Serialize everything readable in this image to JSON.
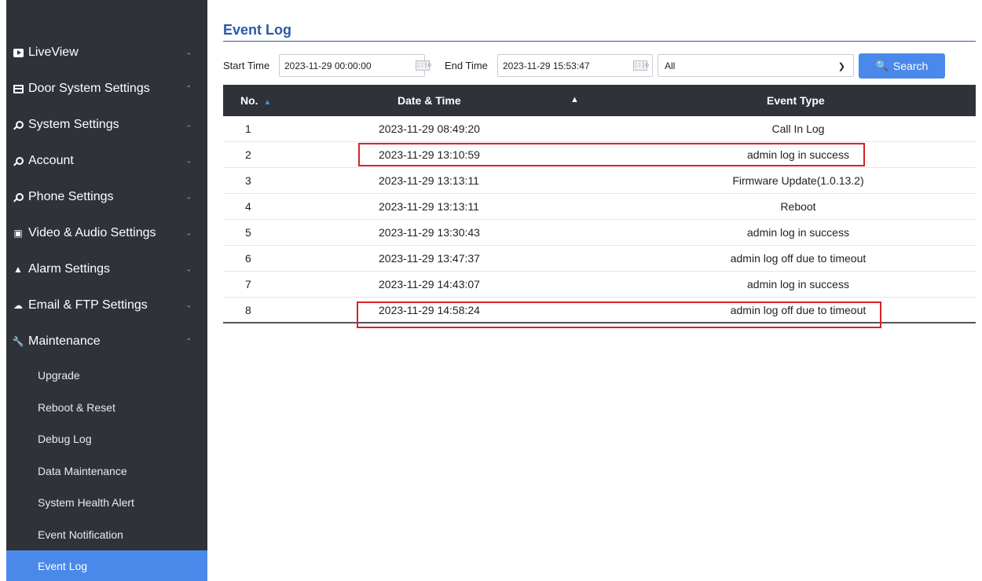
{
  "sidebar": {
    "items": [
      {
        "label": "LiveView",
        "icon": "video-icon"
      },
      {
        "label": "Door System Settings",
        "icon": "card-icon"
      },
      {
        "label": "System Settings",
        "icon": "key-icon"
      },
      {
        "label": "Account",
        "icon": "key-icon"
      },
      {
        "label": "Phone Settings",
        "icon": "key-icon"
      },
      {
        "label": "Video & Audio Settings",
        "icon": "camera-icon"
      },
      {
        "label": "Alarm Settings",
        "icon": "bell-icon"
      },
      {
        "label": "Email & FTP Settings",
        "icon": "cloud-icon"
      },
      {
        "label": "Maintenance",
        "icon": "wrench-icon"
      }
    ],
    "maintenance_items": [
      "Upgrade",
      "Reboot & Reset",
      "Debug Log",
      "Data Maintenance",
      "System Health Alert",
      "Event Notification",
      "Event Log"
    ],
    "active_item": "Event Log"
  },
  "page": {
    "title": "Event Log"
  },
  "filter": {
    "start_label": "Start Time",
    "start_value": "2023-11-29 00:00:00",
    "end_label": "End Time",
    "end_value": "2023-11-29 15:53:47",
    "type_value": "All",
    "search_label": "Search"
  },
  "table": {
    "headers": {
      "no": "No.",
      "datetime": "Date & Time",
      "type": "Event Type"
    },
    "rows": [
      {
        "no": "1",
        "datetime": "2023-11-29 08:49:20",
        "type": "Call In Log"
      },
      {
        "no": "2",
        "datetime": "2023-11-29 13:10:59",
        "type": "admin log in success"
      },
      {
        "no": "3",
        "datetime": "2023-11-29 13:13:11",
        "type": "Firmware Update(1.0.13.2)"
      },
      {
        "no": "4",
        "datetime": "2023-11-29 13:13:11",
        "type": "Reboot"
      },
      {
        "no": "5",
        "datetime": "2023-11-29 13:30:43",
        "type": "admin log in success"
      },
      {
        "no": "6",
        "datetime": "2023-11-29 13:47:37",
        "type": "admin log off due to timeout"
      },
      {
        "no": "7",
        "datetime": "2023-11-29 14:43:07",
        "type": "admin log in success"
      },
      {
        "no": "8",
        "datetime": "2023-11-29 14:58:24",
        "type": "admin log off due to timeout"
      }
    ]
  },
  "colors": {
    "accent": "#4a89ea",
    "sidebar_bg": "#2f3238",
    "highlight": "#d7222a",
    "title": "#2a5aa8"
  }
}
